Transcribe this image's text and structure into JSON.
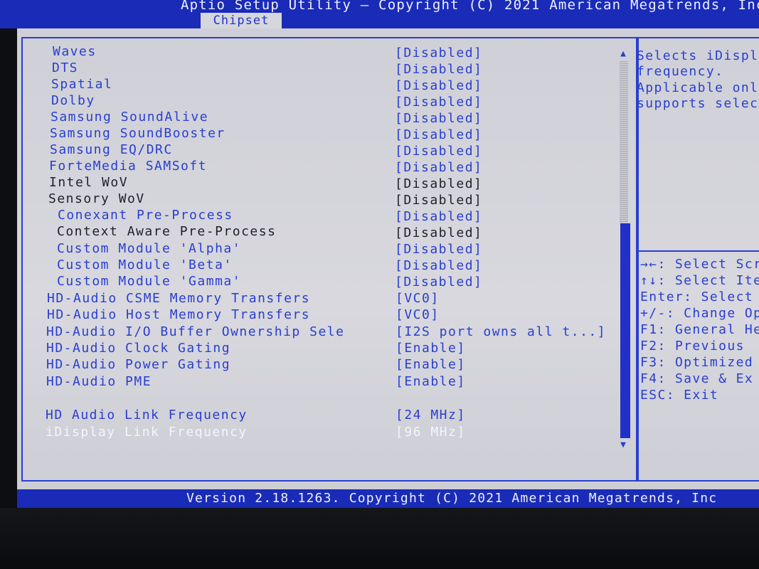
{
  "title": "Aptio Setup Utility – Copyright (C) 2021 American Megatrends, Inc",
  "active_tab": "Chipset",
  "settings": [
    {
      "label": "Waves",
      "value": "[Disabled]"
    },
    {
      "label": "DTS",
      "value": "[Disabled]"
    },
    {
      "label": "Spatial",
      "value": "[Disabled]"
    },
    {
      "label": "Dolby",
      "value": "[Disabled]"
    },
    {
      "label": "Samsung SoundAlive",
      "value": "[Disabled]"
    },
    {
      "label": "Samsung SoundBooster",
      "value": "[Disabled]"
    },
    {
      "label": "Samsung EQ/DRC",
      "value": "[Disabled]"
    },
    {
      "label": "ForteMedia SAMSoft",
      "value": "[Disabled]"
    },
    {
      "label": "Intel WoV",
      "value": "[Disabled]"
    },
    {
      "label": "Sensory WoV",
      "value": "[Disabled]"
    },
    {
      "label": "Conexant Pre-Process",
      "value": "[Disabled]"
    },
    {
      "label": "Context Aware Pre-Process",
      "value": "[Disabled]"
    },
    {
      "label": "Custom Module 'Alpha'",
      "value": "[Disabled]"
    },
    {
      "label": "Custom Module 'Beta'",
      "value": "[Disabled]"
    },
    {
      "label": "Custom Module 'Gamma'",
      "value": "[Disabled]"
    },
    {
      "label": "HD-Audio CSME Memory Transfers",
      "value": "[VC0]"
    },
    {
      "label": "HD-Audio Host Memory Transfers",
      "value": "[VC0]"
    },
    {
      "label": "HD-Audio I/O Buffer Ownership Sele",
      "value": "[I2S port owns all t...]"
    },
    {
      "label": "HD-Audio Clock Gating",
      "value": "[Enable]"
    },
    {
      "label": "HD-Audio Power Gating",
      "value": "[Enable]"
    },
    {
      "label": "HD-Audio PME",
      "value": "[Enable]"
    },
    {
      "label": "HD Audio Link Frequency",
      "value": "[24 MHz]"
    },
    {
      "label": "iDisplay Link Frequency",
      "value": "[96 MHz]"
    }
  ],
  "help": {
    "description": [
      "Selects iDispl",
      "frequency.",
      "Applicable onl",
      "supports selec"
    ],
    "keys": [
      "→←: Select Scr",
      "↑↓: Select Ite",
      "Enter: Select",
      "+/-: Change Op",
      "F1: General He",
      "F2: Previous",
      "F3: Optimized",
      "F4: Save & Ex",
      "ESC: Exit"
    ]
  },
  "footer": "Version 2.18.1263. Copyright (C) 2021 American Megatrends, Inc",
  "colors": {
    "bios_blue": "#2a3ed0",
    "header_blue": "#1a2bb8",
    "panel_grey": "#d3d4da",
    "selected_text": "#f4f5fb",
    "inactive_text": "#1f2128"
  }
}
